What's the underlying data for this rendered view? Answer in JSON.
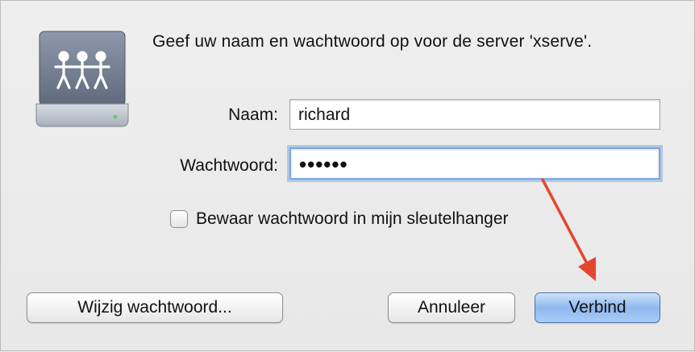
{
  "dialog": {
    "message": "Geef uw naam en wachtwoord op voor de server 'xserve'.",
    "icon": "network-server-icon"
  },
  "form": {
    "name_label": "Naam:",
    "name_value": "richard",
    "password_label": "Wachtwoord:",
    "password_value": "••••••",
    "remember_label": "Bewaar wachtwoord in mijn sleutelhanger",
    "remember_checked": false
  },
  "buttons": {
    "change_password": "Wijzig wachtwoord...",
    "cancel": "Annuleer",
    "connect": "Verbind"
  },
  "colors": {
    "annotation_arrow": "#e5452f",
    "default_button": "#8eb7ee",
    "focus_ring": "#7aa7dc"
  }
}
